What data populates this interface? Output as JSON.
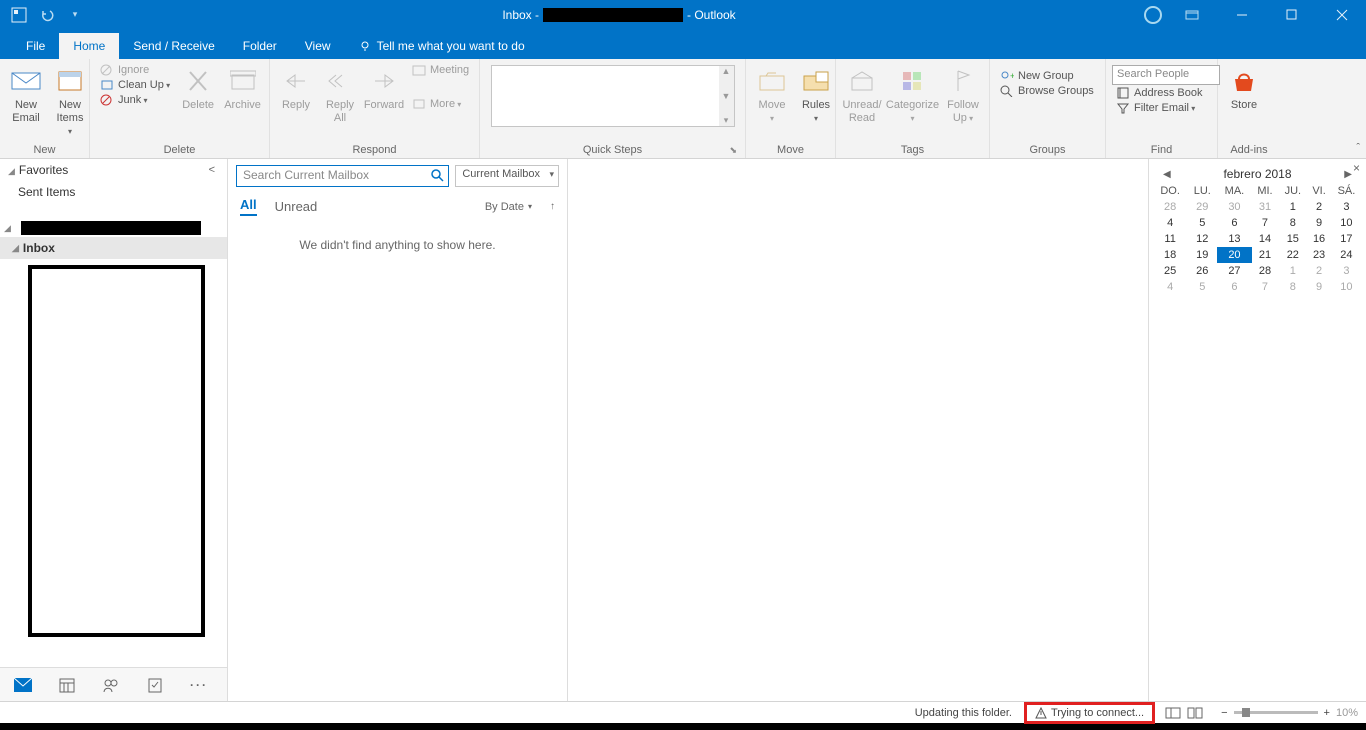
{
  "title": {
    "prefix": "Inbox -",
    "suffix": "- Outlook"
  },
  "tabs": {
    "file": "File",
    "home": "Home",
    "sendrecv": "Send / Receive",
    "folder": "Folder",
    "view": "View",
    "tellme": "Tell me what you want to do"
  },
  "ribbon": {
    "new": {
      "label": "New",
      "new_email": "New\nEmail",
      "new_items": "New\nItems"
    },
    "delete": {
      "label": "Delete",
      "ignore": "Ignore",
      "cleanup": "Clean Up",
      "junk": "Junk",
      "delete": "Delete",
      "archive": "Archive"
    },
    "respond": {
      "label": "Respond",
      "reply": "Reply",
      "reply_all": "Reply\nAll",
      "forward": "Forward",
      "meeting": "Meeting",
      "more": "More"
    },
    "quicksteps": {
      "label": "Quick Steps"
    },
    "move": {
      "label": "Move",
      "move": "Move",
      "rules": "Rules"
    },
    "tags": {
      "label": "Tags",
      "unread": "Unread/\nRead",
      "categorize": "Categorize",
      "followup": "Follow\nUp"
    },
    "groups": {
      "label": "Groups",
      "new_group": "New Group",
      "browse": "Browse Groups"
    },
    "find": {
      "label": "Find",
      "search_ph": "Search People",
      "address": "Address Book",
      "filter": "Filter Email"
    },
    "addins": {
      "label": "Add-ins",
      "store": "Store"
    }
  },
  "nav": {
    "favorites": "Favorites",
    "sent": "Sent Items",
    "inbox": "Inbox"
  },
  "list": {
    "search_ph": "Search Current Mailbox",
    "scope": "Current Mailbox",
    "all": "All",
    "unread": "Unread",
    "sort": "By Date",
    "empty": "We didn't find anything to show here."
  },
  "calendar": {
    "title": "febrero 2018",
    "dow": [
      "DO.",
      "LU.",
      "MA.",
      "MI.",
      "JU.",
      "VI.",
      "SÁ."
    ],
    "weeks": [
      [
        {
          "d": "28",
          "dim": true
        },
        {
          "d": "29",
          "dim": true
        },
        {
          "d": "30",
          "dim": true
        },
        {
          "d": "31",
          "dim": true
        },
        {
          "d": "1"
        },
        {
          "d": "2"
        },
        {
          "d": "3"
        }
      ],
      [
        {
          "d": "4"
        },
        {
          "d": "5"
        },
        {
          "d": "6"
        },
        {
          "d": "7"
        },
        {
          "d": "8"
        },
        {
          "d": "9"
        },
        {
          "d": "10"
        }
      ],
      [
        {
          "d": "11"
        },
        {
          "d": "12"
        },
        {
          "d": "13"
        },
        {
          "d": "14"
        },
        {
          "d": "15"
        },
        {
          "d": "16"
        },
        {
          "d": "17"
        }
      ],
      [
        {
          "d": "18"
        },
        {
          "d": "19"
        },
        {
          "d": "20",
          "today": true
        },
        {
          "d": "21"
        },
        {
          "d": "22"
        },
        {
          "d": "23"
        },
        {
          "d": "24"
        }
      ],
      [
        {
          "d": "25"
        },
        {
          "d": "26"
        },
        {
          "d": "27"
        },
        {
          "d": "28"
        },
        {
          "d": "1",
          "dim": true
        },
        {
          "d": "2",
          "dim": true
        },
        {
          "d": "3",
          "dim": true
        }
      ],
      [
        {
          "d": "4",
          "dim": true
        },
        {
          "d": "5",
          "dim": true
        },
        {
          "d": "6",
          "dim": true
        },
        {
          "d": "7",
          "dim": true
        },
        {
          "d": "8",
          "dim": true
        },
        {
          "d": "9",
          "dim": true
        },
        {
          "d": "10",
          "dim": true
        }
      ]
    ]
  },
  "status": {
    "updating": "Updating this folder.",
    "connecting": "Trying to connect...",
    "zoom": "10%"
  }
}
